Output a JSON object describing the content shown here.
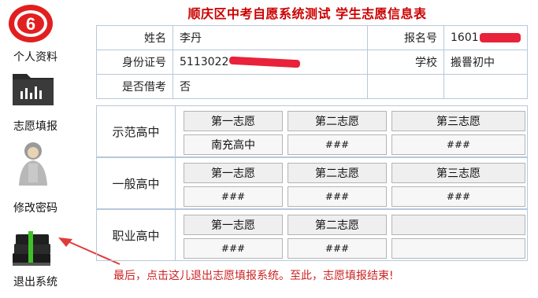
{
  "title": "顺庆区中考自愿系统测试  学生志愿信息表",
  "sidebar": {
    "items": [
      {
        "label": "个人资料"
      },
      {
        "label": "志愿填报"
      },
      {
        "label": "修改密码"
      },
      {
        "label": "退出系统"
      }
    ]
  },
  "info": {
    "name_label": "姓名",
    "name_value": "李丹",
    "regno_label": "报名号",
    "regno_value": "1601",
    "id_label": "身份证号",
    "id_value": "5113022",
    "school_label": "学校",
    "school_value": "搬罾初中",
    "borrow_label": "是否借考",
    "borrow_value": "否"
  },
  "sections": {
    "model": {
      "label": "示范高中",
      "headers": [
        "第一志愿",
        "第二志愿",
        "第三志愿"
      ],
      "values": [
        "南充高中",
        "###",
        "###"
      ]
    },
    "general": {
      "label": "一般高中",
      "headers": [
        "第一志愿",
        "第二志愿",
        "第三志愿"
      ],
      "values": [
        "###",
        "###",
        "###"
      ]
    },
    "vocational": {
      "label": "职业高中",
      "headers": [
        "第一志愿",
        "第二志愿",
        ""
      ],
      "values": [
        "###",
        "###",
        ""
      ]
    }
  },
  "footer_note": "最后，点击这儿退出志愿填报系统。至此，志愿填报结束!",
  "colors": {
    "title": "#cc0000",
    "annotation": "#cc2222",
    "redaction": "#e8223a",
    "border": "#b7c8db"
  }
}
